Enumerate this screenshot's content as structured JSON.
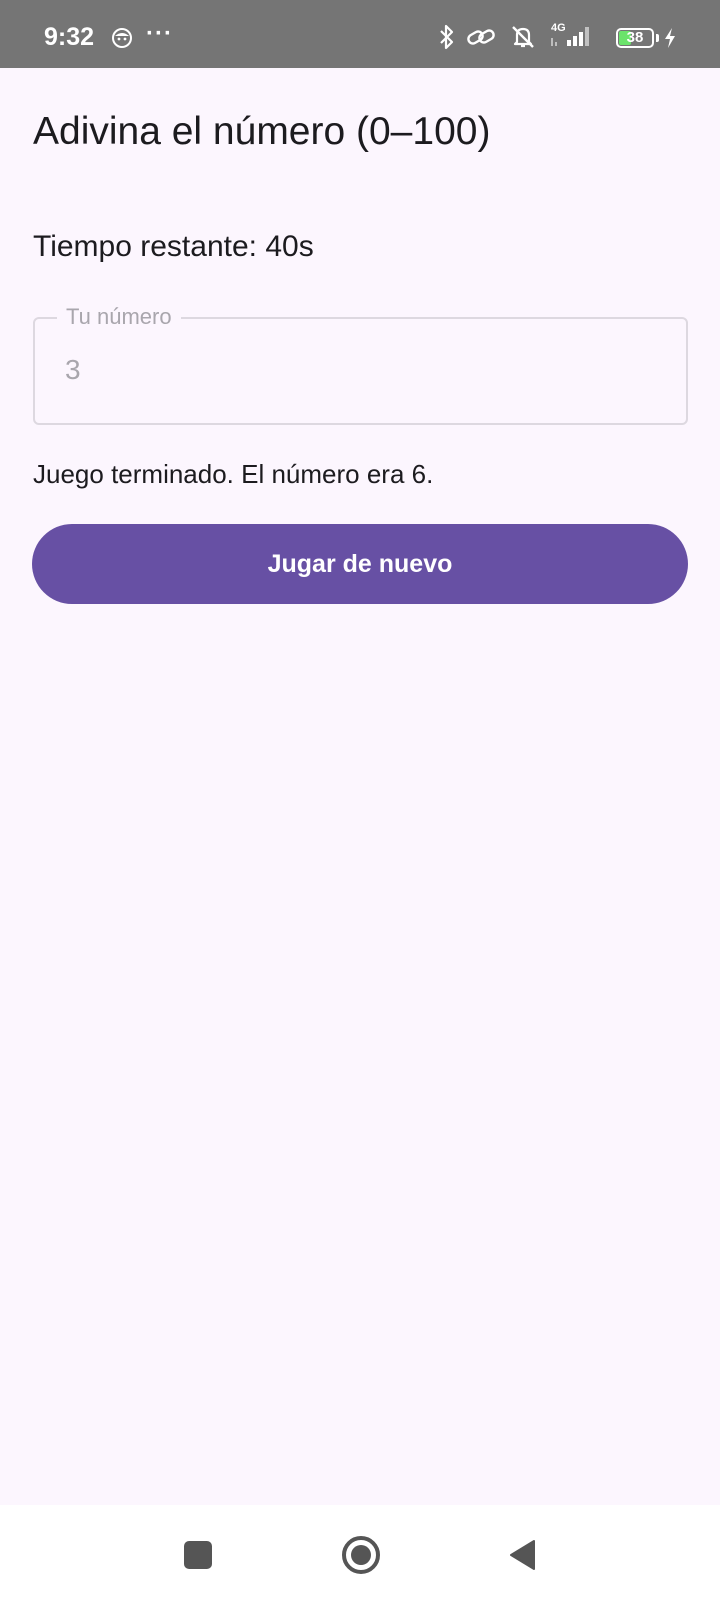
{
  "status_bar": {
    "time": "9:32",
    "more": "···",
    "battery_level": "38",
    "battery_fraction": 0.38,
    "icons": [
      "face-icon",
      "bluetooth-icon",
      "link-icon",
      "mute-icon",
      "signal-4g-icon",
      "battery-icon",
      "charging-icon"
    ],
    "network_label": "4G"
  },
  "app": {
    "title": "Adivina el número (0–100)",
    "timer_text": "Tiempo restante: 40s",
    "input": {
      "label": "Tu número",
      "value": "3"
    },
    "message": "Juego terminado. El número era 6.",
    "play_again_label": "Jugar de nuevo"
  },
  "nav_bar": {
    "icons": [
      "recents-icon",
      "home-icon",
      "back-icon"
    ]
  },
  "colors": {
    "background": "#FCF6FE",
    "primary": "#6750A4",
    "status_bar": "#757575",
    "text": "#1C1B1F",
    "muted": "#A9A6AD",
    "battery_fill": "#6BE36B"
  }
}
